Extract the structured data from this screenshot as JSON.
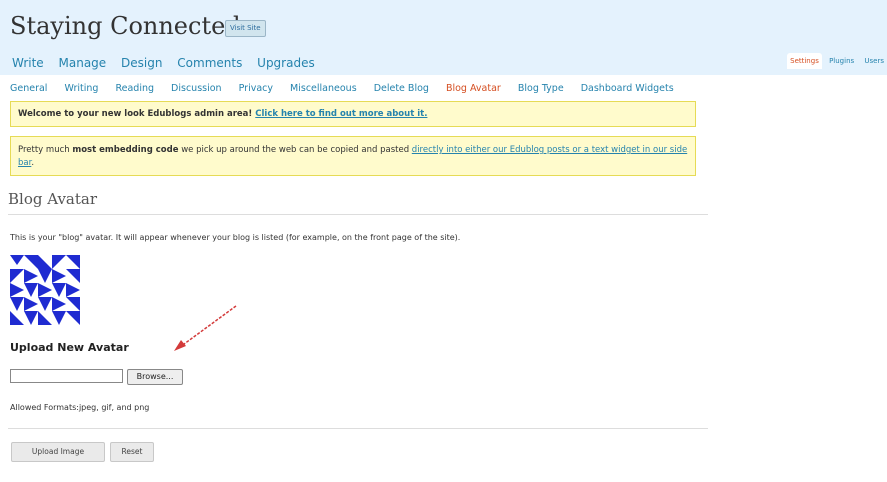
{
  "header": {
    "site_title": "Staying Connected",
    "visit_site": "Visit Site",
    "main_nav": [
      "Write",
      "Manage",
      "Design",
      "Comments",
      "Upgrades"
    ],
    "right_tabs": [
      "Settings",
      "Plugins",
      "Users"
    ],
    "active_right_tab": "Settings"
  },
  "sub_nav": {
    "items": [
      "General",
      "Writing",
      "Reading",
      "Discussion",
      "Privacy",
      "Miscellaneous",
      "Delete Blog",
      "Blog Avatar",
      "Blog Type",
      "Dashboard Widgets"
    ],
    "active": "Blog Avatar"
  },
  "notices": {
    "welcome_text": "Welcome to your new look Edublogs admin area!",
    "welcome_link": "Click here to find out more about it.",
    "embed_prefix": "Pretty much ",
    "embed_bold": "most embedding code",
    "embed_middle": " we pick up around the web can be copied and pasted ",
    "embed_link": "directly into either our Edublog posts or a text widget in our side bar",
    "embed_suffix": "."
  },
  "main": {
    "title": "Blog Avatar",
    "description": "This is your \"blog\" avatar. It will appear whenever your blog is listed (for example, on the front page of the site).",
    "upload_heading": "Upload New Avatar",
    "file_value": "",
    "browse_label": "Browse...",
    "allowed_formats": "Allowed Formats:jpeg, gif, and png",
    "upload_button": "Upload Image",
    "reset_button": "Reset"
  },
  "colors": {
    "header_bg": "#e4f2fd",
    "link": "#2583ad",
    "active": "#d54e21",
    "avatar": "#1f2bd1",
    "notice_bg": "#fffbcc",
    "arrow": "#d33a3a"
  },
  "icons": {
    "avatar": "identicon-avatar",
    "annotation": "red-arrow-annotation"
  }
}
